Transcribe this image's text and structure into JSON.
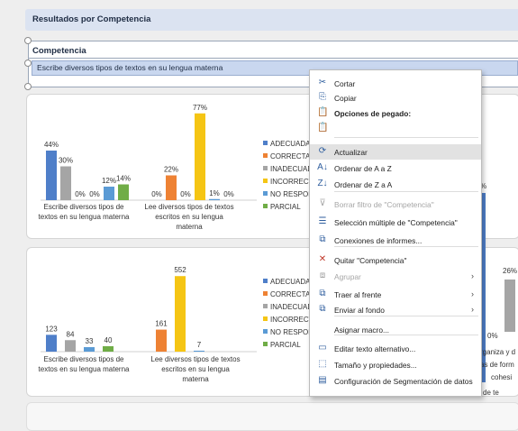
{
  "banner": {
    "title": "Resultados por Competencia"
  },
  "slicer": {
    "title": "Competencia",
    "selected_item": "Escribe diversos tipos de textos en su lengua materna"
  },
  "colors": {
    "ADECUADA": "#4f7fc9",
    "CORRECTA": "#ee8234",
    "INADECUADA": "#a5a5a5",
    "INCORRECTA": "#f5c514",
    "NO RESPONDE": "#5b9bd5",
    "PARCIAL": "#70ad47"
  },
  "legend": {
    "top": [
      "ADECUADA",
      "CORRECTA",
      "INADECUAD",
      "INCORRECT",
      "NO RESPON",
      "PARCIAL"
    ],
    "bottom": [
      "ADECUADA",
      "CORRECTA",
      "INADECUAD",
      "INCORRECTA",
      "NO RESPON",
      "PARCIAL"
    ]
  },
  "right_fragment": {
    "label_top": "%",
    "label_bottom": "26%",
    "label_zero": "0%",
    "text_1": "rganiza y d",
    "text_2": "as de form",
    "text_3": "cohesi",
    "text_4": "Escribe diversos tipos de te"
  },
  "chart_data": [
    {
      "type": "bar",
      "categories": [
        "Escribe diversos tipos de textos en su lengua materna",
        "Lee diversos tipos de textos escritos en su lengua materna"
      ],
      "series": [
        {
          "name": "ADECUADA",
          "values": [
            44,
            0
          ]
        },
        {
          "name": "INADECUADA",
          "values": [
            30,
            0
          ]
        },
        {
          "name": "INCORRECTA",
          "values": [
            0,
            77
          ]
        },
        {
          "name": "NO RESPONDE",
          "values": [
            12,
            1
          ]
        },
        {
          "name": "PARCIAL",
          "values": [
            14,
            0
          ]
        },
        {
          "name": "CORRECTA",
          "values": [
            0,
            22
          ]
        }
      ],
      "bars": [
        [
          {
            "s": "ADECUADA",
            "v": 44,
            "l": "44%"
          },
          {
            "s": "INADECUADA",
            "v": 30,
            "l": "30%"
          },
          {
            "s": "INCORRECTA",
            "v": 0,
            "l": "0%"
          },
          {
            "s": "INCORRECTA",
            "v": 0,
            "l": "0%"
          },
          {
            "s": "NO RESPONDE",
            "v": 12,
            "l": "12%"
          },
          {
            "s": "PARCIAL",
            "v": 14,
            "l": "14%"
          }
        ],
        [
          {
            "s": "ADECUADA",
            "v": 0,
            "l": "0%"
          },
          {
            "s": "CORRECTA",
            "v": 22,
            "l": "22%"
          },
          {
            "s": "INADECUADA",
            "v": 0,
            "l": "0%"
          },
          {
            "s": "INCORRECTA",
            "v": 77,
            "l": "77%"
          },
          {
            "s": "NO RESPONDE",
            "v": 1,
            "l": "1%"
          },
          {
            "s": "PARCIAL",
            "v": 0,
            "l": "0%"
          }
        ]
      ],
      "ylim": [
        0,
        80
      ]
    },
    {
      "type": "bar",
      "categories": [
        "Escribe diversos tipos de textos en su lengua materna",
        "Lee diversos tipos de textos escritos en su lengua materna"
      ],
      "series": [
        {
          "name": "ADECUADA",
          "values": [
            123,
            0
          ]
        },
        {
          "name": "INADECUADA",
          "values": [
            84,
            0
          ]
        },
        {
          "name": "NO RESPONDE",
          "values": [
            33,
            0
          ]
        },
        {
          "name": "PARCIAL",
          "values": [
            40,
            0
          ]
        },
        {
          "name": "CORRECTA",
          "values": [
            0,
            161
          ]
        },
        {
          "name": "INCORRECTA",
          "values": [
            0,
            552
          ]
        },
        {
          "name": "NO RESPONDE",
          "values": [
            0,
            7
          ]
        }
      ],
      "bars": [
        [
          {
            "s": "ADECUADA",
            "v": 123,
            "l": "123"
          },
          {
            "s": "INADECUADA",
            "v": 84,
            "l": "84"
          },
          {
            "s": "NO RESPONDE",
            "v": 33,
            "l": "33"
          },
          {
            "s": "PARCIAL",
            "v": 40,
            "l": "40"
          }
        ],
        [
          {
            "s": "CORRECTA",
            "v": 161,
            "l": "161"
          },
          {
            "s": "INCORRECTA",
            "v": 552,
            "l": "552"
          },
          {
            "s": "NO RESPONDE",
            "v": 7,
            "l": "7"
          }
        ]
      ],
      "ylim": [
        0,
        560
      ]
    }
  ],
  "context_menu": {
    "items": [
      {
        "icon": "✂",
        "icon_name": "cut-icon",
        "label": "Cortar"
      },
      {
        "icon": "⎘",
        "icon_name": "copy-icon",
        "label": "Copiar"
      },
      {
        "icon": "📋",
        "icon_name": "paste-options-icon",
        "label": "Opciones de pegado:",
        "bold": true
      },
      {
        "icon": "📋",
        "icon_name": "paste-icon",
        "label": ""
      },
      {
        "icon": "⟳",
        "icon_name": "refresh-icon",
        "label": "Actualizar",
        "highlight": true
      },
      {
        "icon": "A↓",
        "icon_name": "sort-asc-icon",
        "label": "Ordenar de A a Z"
      },
      {
        "icon": "Z↓",
        "icon_name": "sort-desc-icon",
        "label": "Ordenar de Z a A"
      },
      {
        "icon": "⊽",
        "icon_name": "clear-filter-icon",
        "label": "Borrar filtro de \"Competencia\"",
        "disabled": true
      },
      {
        "icon": "☰",
        "icon_name": "multi-select-icon",
        "label": "Selección múltiple de \"Competencia\""
      },
      {
        "icon": "⧉",
        "icon_name": "report-connections-icon",
        "label": "Conexiones de informes..."
      },
      {
        "icon": "✕",
        "icon_name": "remove-icon",
        "label": "Quitar \"Competencia\""
      },
      {
        "icon": "⧈",
        "icon_name": "group-icon",
        "label": "Agrupar",
        "disabled": true,
        "submenu": true
      },
      {
        "icon": "⧉",
        "icon_name": "bring-front-icon",
        "label": "Traer al frente",
        "submenu": true
      },
      {
        "icon": "⧉",
        "icon_name": "send-back-icon",
        "label": "Enviar al fondo",
        "submenu": true
      },
      {
        "icon": "",
        "icon_name": "",
        "label": "Asignar macro..."
      },
      {
        "icon": "▭",
        "icon_name": "alt-text-icon",
        "label": "Editar texto alternativo..."
      },
      {
        "icon": "⬚",
        "icon_name": "size-properties-icon",
        "label": "Tamaño y propiedades..."
      },
      {
        "icon": "▤",
        "icon_name": "slicer-settings-icon",
        "label": "Configuración de Segmentación de datos"
      }
    ]
  }
}
